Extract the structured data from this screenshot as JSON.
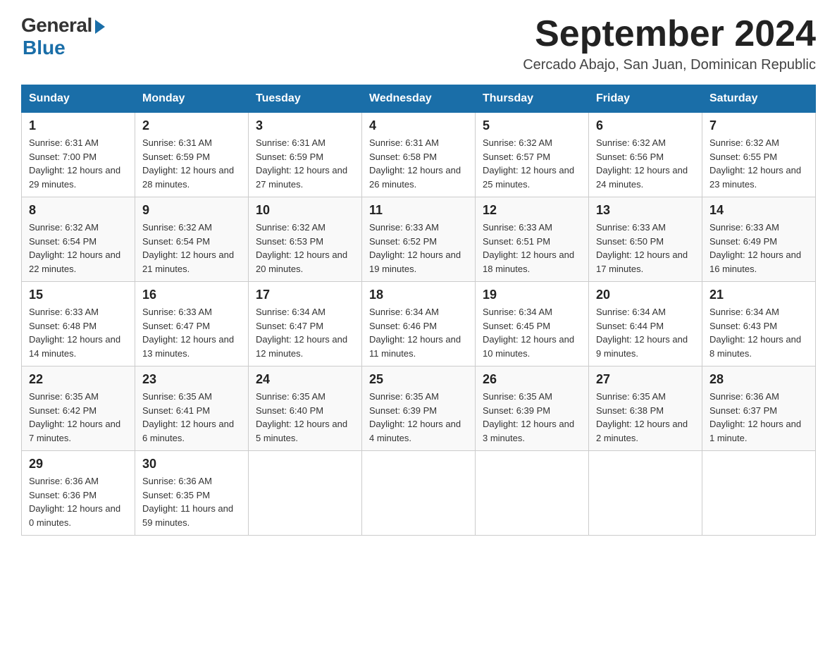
{
  "header": {
    "logo_general": "General",
    "logo_blue": "Blue",
    "month_title": "September 2024",
    "location": "Cercado Abajo, San Juan, Dominican Republic"
  },
  "days_of_week": [
    "Sunday",
    "Monday",
    "Tuesday",
    "Wednesday",
    "Thursday",
    "Friday",
    "Saturday"
  ],
  "weeks": [
    [
      {
        "day": "1",
        "sunrise": "6:31 AM",
        "sunset": "7:00 PM",
        "daylight": "12 hours and 29 minutes."
      },
      {
        "day": "2",
        "sunrise": "6:31 AM",
        "sunset": "6:59 PM",
        "daylight": "12 hours and 28 minutes."
      },
      {
        "day": "3",
        "sunrise": "6:31 AM",
        "sunset": "6:59 PM",
        "daylight": "12 hours and 27 minutes."
      },
      {
        "day": "4",
        "sunrise": "6:31 AM",
        "sunset": "6:58 PM",
        "daylight": "12 hours and 26 minutes."
      },
      {
        "day": "5",
        "sunrise": "6:32 AM",
        "sunset": "6:57 PM",
        "daylight": "12 hours and 25 minutes."
      },
      {
        "day": "6",
        "sunrise": "6:32 AM",
        "sunset": "6:56 PM",
        "daylight": "12 hours and 24 minutes."
      },
      {
        "day": "7",
        "sunrise": "6:32 AM",
        "sunset": "6:55 PM",
        "daylight": "12 hours and 23 minutes."
      }
    ],
    [
      {
        "day": "8",
        "sunrise": "6:32 AM",
        "sunset": "6:54 PM",
        "daylight": "12 hours and 22 minutes."
      },
      {
        "day": "9",
        "sunrise": "6:32 AM",
        "sunset": "6:54 PM",
        "daylight": "12 hours and 21 minutes."
      },
      {
        "day": "10",
        "sunrise": "6:32 AM",
        "sunset": "6:53 PM",
        "daylight": "12 hours and 20 minutes."
      },
      {
        "day": "11",
        "sunrise": "6:33 AM",
        "sunset": "6:52 PM",
        "daylight": "12 hours and 19 minutes."
      },
      {
        "day": "12",
        "sunrise": "6:33 AM",
        "sunset": "6:51 PM",
        "daylight": "12 hours and 18 minutes."
      },
      {
        "day": "13",
        "sunrise": "6:33 AM",
        "sunset": "6:50 PM",
        "daylight": "12 hours and 17 minutes."
      },
      {
        "day": "14",
        "sunrise": "6:33 AM",
        "sunset": "6:49 PM",
        "daylight": "12 hours and 16 minutes."
      }
    ],
    [
      {
        "day": "15",
        "sunrise": "6:33 AM",
        "sunset": "6:48 PM",
        "daylight": "12 hours and 14 minutes."
      },
      {
        "day": "16",
        "sunrise": "6:33 AM",
        "sunset": "6:47 PM",
        "daylight": "12 hours and 13 minutes."
      },
      {
        "day": "17",
        "sunrise": "6:34 AM",
        "sunset": "6:47 PM",
        "daylight": "12 hours and 12 minutes."
      },
      {
        "day": "18",
        "sunrise": "6:34 AM",
        "sunset": "6:46 PM",
        "daylight": "12 hours and 11 minutes."
      },
      {
        "day": "19",
        "sunrise": "6:34 AM",
        "sunset": "6:45 PM",
        "daylight": "12 hours and 10 minutes."
      },
      {
        "day": "20",
        "sunrise": "6:34 AM",
        "sunset": "6:44 PM",
        "daylight": "12 hours and 9 minutes."
      },
      {
        "day": "21",
        "sunrise": "6:34 AM",
        "sunset": "6:43 PM",
        "daylight": "12 hours and 8 minutes."
      }
    ],
    [
      {
        "day": "22",
        "sunrise": "6:35 AM",
        "sunset": "6:42 PM",
        "daylight": "12 hours and 7 minutes."
      },
      {
        "day": "23",
        "sunrise": "6:35 AM",
        "sunset": "6:41 PM",
        "daylight": "12 hours and 6 minutes."
      },
      {
        "day": "24",
        "sunrise": "6:35 AM",
        "sunset": "6:40 PM",
        "daylight": "12 hours and 5 minutes."
      },
      {
        "day": "25",
        "sunrise": "6:35 AM",
        "sunset": "6:39 PM",
        "daylight": "12 hours and 4 minutes."
      },
      {
        "day": "26",
        "sunrise": "6:35 AM",
        "sunset": "6:39 PM",
        "daylight": "12 hours and 3 minutes."
      },
      {
        "day": "27",
        "sunrise": "6:35 AM",
        "sunset": "6:38 PM",
        "daylight": "12 hours and 2 minutes."
      },
      {
        "day": "28",
        "sunrise": "6:36 AM",
        "sunset": "6:37 PM",
        "daylight": "12 hours and 1 minute."
      }
    ],
    [
      {
        "day": "29",
        "sunrise": "6:36 AM",
        "sunset": "6:36 PM",
        "daylight": "12 hours and 0 minutes."
      },
      {
        "day": "30",
        "sunrise": "6:36 AM",
        "sunset": "6:35 PM",
        "daylight": "11 hours and 59 minutes."
      },
      null,
      null,
      null,
      null,
      null
    ]
  ],
  "labels": {
    "sunrise_prefix": "Sunrise: ",
    "sunset_prefix": "Sunset: ",
    "daylight_prefix": "Daylight: "
  }
}
